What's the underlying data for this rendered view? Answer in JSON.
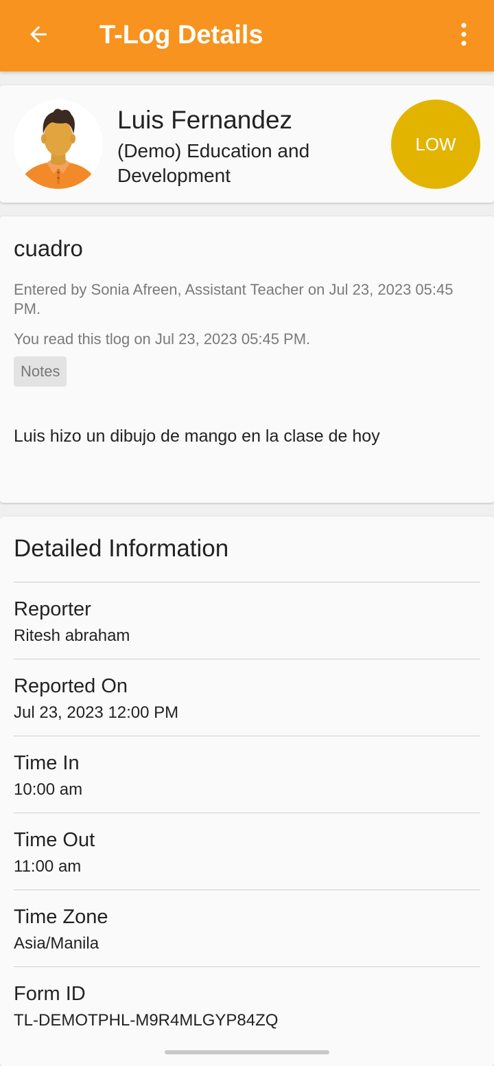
{
  "app_bar": {
    "title": "T-Log Details",
    "background_color": "#f7931e",
    "back_icon": "arrow-left-icon",
    "menu_icon": "more-vertical-icon"
  },
  "student": {
    "name": "Luis Fernandez",
    "program": "(Demo) Education and Development",
    "avatar_icon": "student-avatar-icon",
    "priority": "LOW",
    "priority_color": "#e2b400"
  },
  "log": {
    "title": "cuadro",
    "entered_by": "Entered by Sonia Afreen, Assistant Teacher on Jul 23, 2023 05:45 PM.",
    "read_status": "You read this tlog on Jul 23, 2023 05:45 PM.",
    "tag": "Notes",
    "body": "Luis hizo un dibujo de mango en la clase de hoy"
  },
  "details": {
    "heading": "Detailed Information",
    "fields": [
      {
        "label": "Reporter",
        "value": "Ritesh abraham"
      },
      {
        "label": "Reported On",
        "value": "Jul 23, 2023 12:00 PM"
      },
      {
        "label": "Time In",
        "value": "10:00 am"
      },
      {
        "label": "Time Out",
        "value": "11:00 am"
      },
      {
        "label": "Time Zone",
        "value": "Asia/Manila"
      },
      {
        "label": "Form ID",
        "value": "TL-DEMOTPHL-M9R4MLGYP84ZQ"
      }
    ]
  }
}
